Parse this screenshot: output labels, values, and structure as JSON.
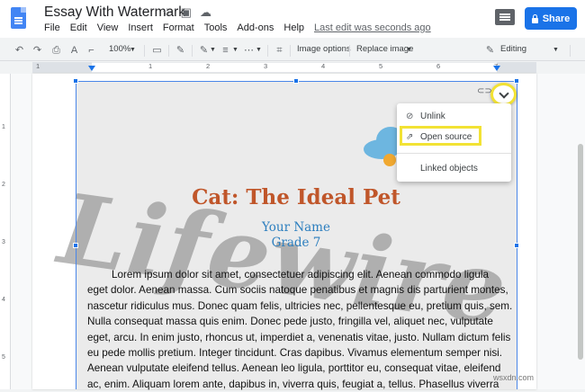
{
  "document": {
    "title": "Essay With Watermark",
    "last_edit": "Last edit was seconds ago"
  },
  "menu": [
    "File",
    "Edit",
    "View",
    "Insert",
    "Format",
    "Tools",
    "Add-ons",
    "Help"
  ],
  "header": {
    "share_label": "Share"
  },
  "toolbar": {
    "zoom": "100%",
    "image_options": "Image options",
    "replace_image": "Replace image",
    "mode": "Editing"
  },
  "ruler": {
    "marks": [
      "1",
      "1",
      "2",
      "3",
      "4",
      "5",
      "6",
      "7"
    ],
    "side_marks": [
      "1",
      "2",
      "3",
      "4",
      "5"
    ]
  },
  "content": {
    "watermark_text": "Lifewire",
    "title": "Cat: The Ideal Pet",
    "author": "Your Name",
    "grade": "Grade 7",
    "body_lines": [
      "Lorem ipsum dolor sit amet, consectetuer adipiscing elit. Aenean commodo ligula",
      "eget dolor. Aenean massa. Cum sociis natoque penatibus et magnis dis parturient montes,",
      "nascetur ridiculus mus. Donec quam felis, ultricies nec, pellentesque eu, pretium quis, sem.",
      "Nulla consequat massa quis enim. Donec pede justo, fringilla vel, aliquet nec, vulputate",
      "eget, arcu. In enim justo, rhoncus ut, imperdiet a, venenatis vitae, justo. Nullam dictum felis",
      "eu pede mollis pretium. Integer tincidunt. Cras dapibus. Vivamus elementum semper nisi.",
      "Aenean vulputate eleifend tellus. Aenean leo ligula, porttitor eu, consequat vitae, eleifend",
      "ac, enim. Aliquam lorem ante, dapibus in, viverra quis, feugiat a, tellus. Phasellus viverra"
    ]
  },
  "link_menu": {
    "unlink": "Unlink",
    "open_source": "Open source",
    "linked_objects": "Linked objects"
  },
  "site_watermark": "wsxdn.com",
  "colors": {
    "accent": "#1a73e8",
    "highlight": "#f2e234",
    "title": "#c0562a",
    "subtitle": "#2d7fbf"
  }
}
